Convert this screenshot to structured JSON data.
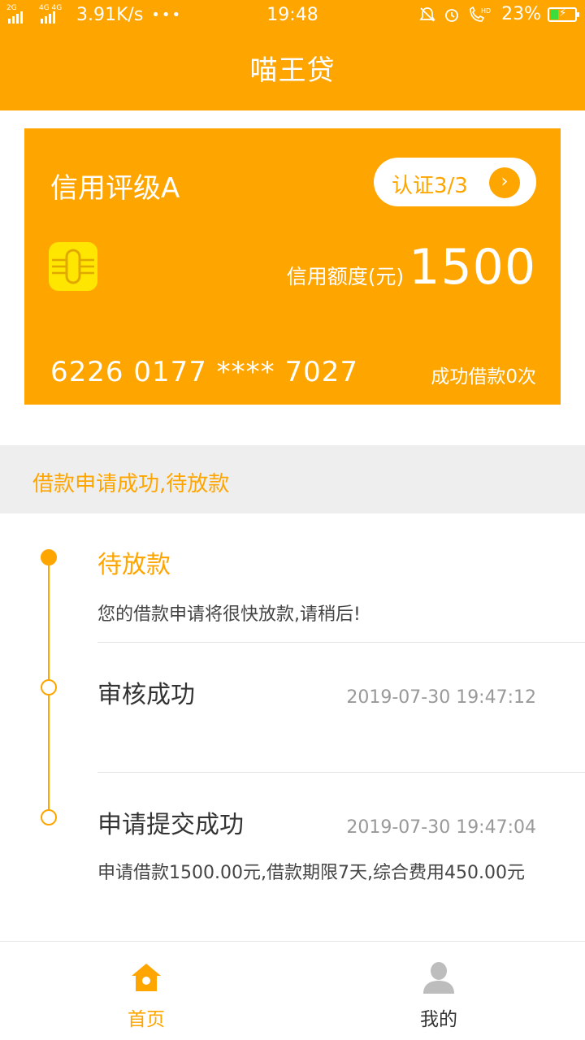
{
  "status_bar": {
    "network_left": "2G",
    "network_right": "4G 4G",
    "speed": "3.91K/s",
    "more": "•••",
    "time": "19:48",
    "battery": "23%",
    "icons": [
      "mute-icon",
      "alarm-icon",
      "hd-call-icon",
      "battery-icon"
    ]
  },
  "header": {
    "title": "喵王贷"
  },
  "card": {
    "rating": "信用评级A",
    "verify_label": "认证3/3",
    "limit_label": "信用额度(元)",
    "limit_amount": "1500",
    "card_number": "6226 0177 **** 7027",
    "loan_count": "成功借款0次"
  },
  "notice": {
    "text": "借款申请成功,待放款"
  },
  "timeline": {
    "steps": [
      {
        "title": "待放款",
        "desc": "您的借款申请将很快放款,请稍后!",
        "time": ""
      },
      {
        "title": "审核成功",
        "desc": "",
        "time": "2019-07-30 19:47:12"
      },
      {
        "title": "申请提交成功",
        "desc": "申请借款1500.00元,借款期限7天,综合费用450.00元",
        "time": "2019-07-30 19:47:04"
      }
    ]
  },
  "bottom_nav": {
    "home": "首页",
    "mine": "我的"
  },
  "colors": {
    "accent": "#FFA500",
    "chip": "#FFE600",
    "inactive_icon": "#BDBDBD"
  }
}
